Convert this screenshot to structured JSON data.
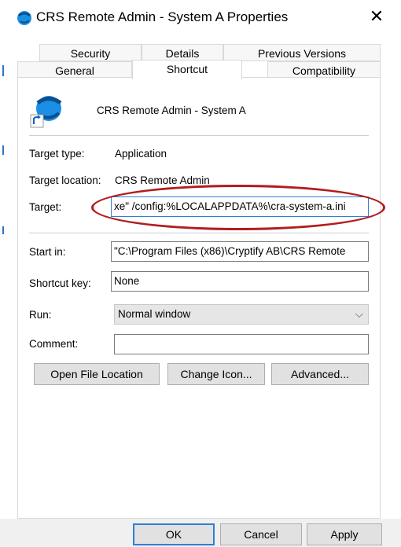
{
  "window": {
    "title": "CRS Remote Admin - System A Properties"
  },
  "tabs": {
    "row1": [
      "Security",
      "Details",
      "Previous Versions"
    ],
    "row2": [
      "General",
      "Shortcut",
      "Compatibility"
    ],
    "active": "Shortcut"
  },
  "shortcut": {
    "name": "CRS Remote Admin - System A",
    "target_type_label": "Target type:",
    "target_type_value": "Application",
    "target_location_label": "Target location:",
    "target_location_value": "CRS Remote Admin",
    "target_label": "Target:",
    "target_value": "xe\" /config:%LOCALAPPDATA%\\cra-system-a.ini",
    "start_in_label": "Start in:",
    "start_in_value": "\"C:\\Program Files (x86)\\Cryptify AB\\CRS Remote",
    "shortcut_key_label": "Shortcut key:",
    "shortcut_key_value": "None",
    "run_label": "Run:",
    "run_value": "Normal window",
    "comment_label": "Comment:",
    "comment_value": ""
  },
  "buttons": {
    "open_file_location": "Open File Location",
    "change_icon": "Change Icon...",
    "advanced": "Advanced...",
    "ok": "OK",
    "cancel": "Cancel",
    "apply": "Apply"
  },
  "colors": {
    "highlight_ellipse": "#b01e1e",
    "focus_border": "#2f7fd6"
  },
  "icons": {
    "app": "crs-globe-icon",
    "shortcut_overlay": "shortcut-arrow-icon",
    "close": "close-icon",
    "dropdown": "chevron-down-icon"
  }
}
